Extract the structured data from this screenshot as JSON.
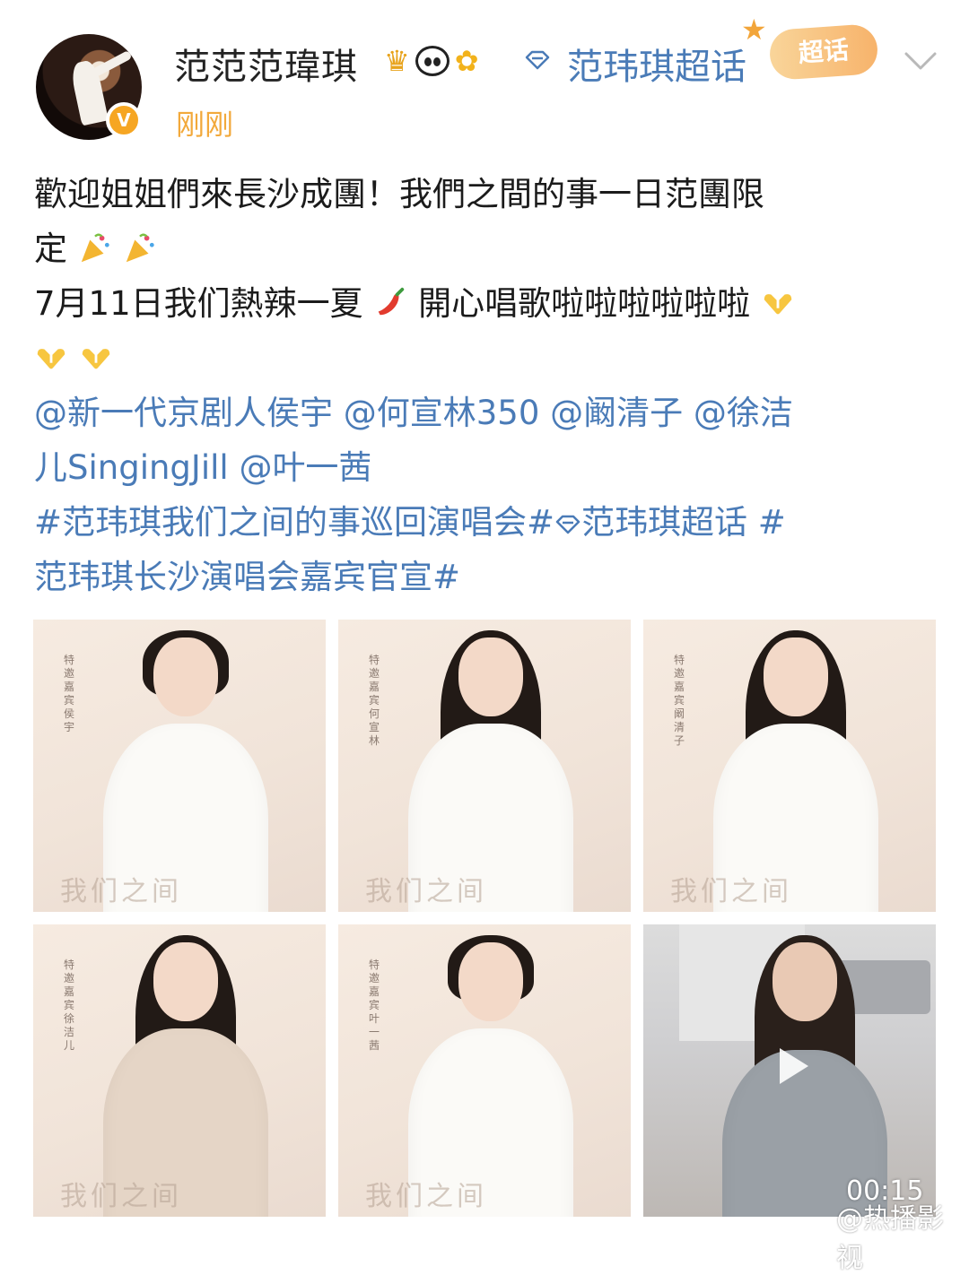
{
  "post": {
    "username": "范范范瑋琪",
    "chaohua_label": "范玮琪超话",
    "chaohua_sticker": "超话",
    "time": "刚刚",
    "verified_badge": "V",
    "line1": "歡迎姐姐們來長沙成團！我們之間的事一日范團限",
    "line2": "定",
    "line3": "7月11日我们熱辣一夏",
    "line3b": "開心唱歌啦啦啦啦啦啦",
    "mentions": [
      "@新一代京剧人侯宇",
      "@何宣林350",
      "@阚清子",
      "@徐洁",
      "儿SingingJill",
      "@叶一茜"
    ],
    "hashtags": [
      "#范玮琪我们之间的事巡回演唱会#",
      "范玮琪超话",
      "#",
      "范玮琪长沙演唱会嘉宾官宣#"
    ]
  },
  "media": {
    "images": [
      {
        "caption": "特邀嘉宾 侯宇",
        "watermark": "我们之间"
      },
      {
        "caption": "特邀嘉宾 何宣林",
        "watermark": "我们之间"
      },
      {
        "caption": "特邀嘉宾 阚清子",
        "watermark": "我们之间"
      },
      {
        "caption": "特邀嘉宾 徐洁儿",
        "watermark": "我们之间"
      },
      {
        "caption": "特邀嘉宾 叶一茜",
        "watermark": "我们之间"
      }
    ],
    "video_duration": "00:15"
  },
  "watermark": "@热播影视",
  "icons": {
    "crown": "crown-icon",
    "panda": "panda-icon",
    "flower": "sunflower-icon",
    "chaohua": "diamond-icon",
    "more": "chevron-down-icon",
    "play": "play-icon",
    "party": "party-popper-icon",
    "pepper": "chili-pepper-icon",
    "heart_hands": "heart-hands-icon"
  },
  "colors": {
    "link": "#4a7bb7",
    "time": "#f2a93b",
    "verified": "#f6a623"
  }
}
